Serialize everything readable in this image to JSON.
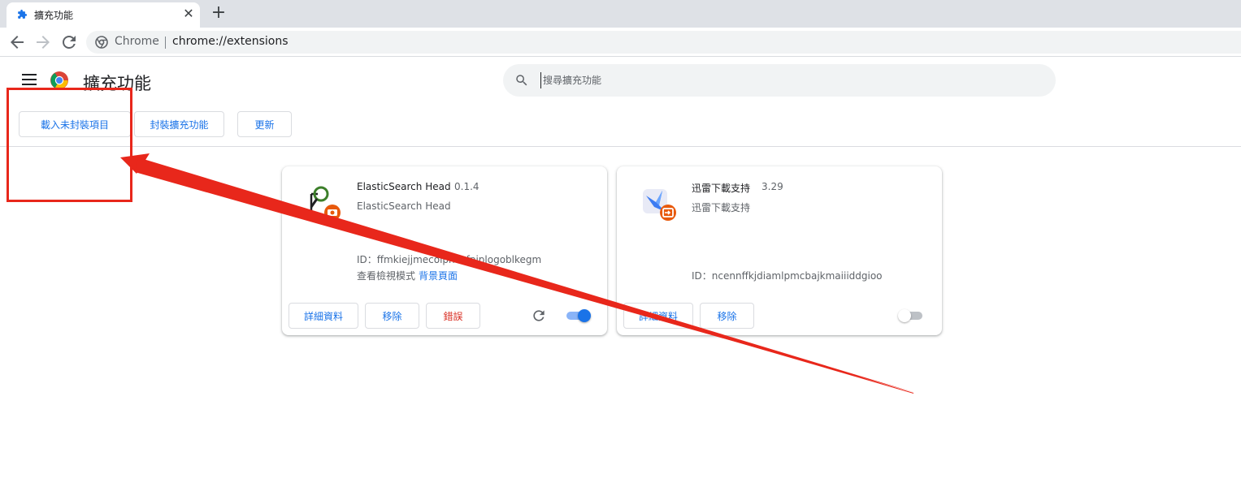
{
  "tab": {
    "title": "擴充功能",
    "close_glyph": "✕",
    "new_tab_glyph": "+"
  },
  "toolbar": {
    "site_name": "Chrome",
    "url": "chrome://extensions"
  },
  "header": {
    "title": "擴充功能",
    "search_placeholder": "搜尋擴充功能"
  },
  "dev_buttons": {
    "load_unpacked": "載入未封裝項目",
    "pack": "封裝擴充功能",
    "update": "更新"
  },
  "extensions": [
    {
      "name": "ElasticSearch Head",
      "version": "0.1.4",
      "description": "ElasticSearch Head",
      "id_label": "ID：ffmkiejjmecolpnecfpiplogoblkegm",
      "views_label": "查看檢視模式",
      "views_link": "背景頁面",
      "details": "詳細資料",
      "remove": "移除",
      "errors": "錯誤",
      "enabled": true
    },
    {
      "name": "迅雷下載支持",
      "version": "3.29",
      "description": "迅雷下載支持",
      "id_label": "ID：ncennffkjdiamlpmcbajkmaiiiddgioo",
      "details": "詳細資料",
      "remove": "移除",
      "enabled": false
    }
  ],
  "colors": {
    "accent": "#1a73e8",
    "error": "#d93025",
    "annotation": "#e8271b"
  }
}
